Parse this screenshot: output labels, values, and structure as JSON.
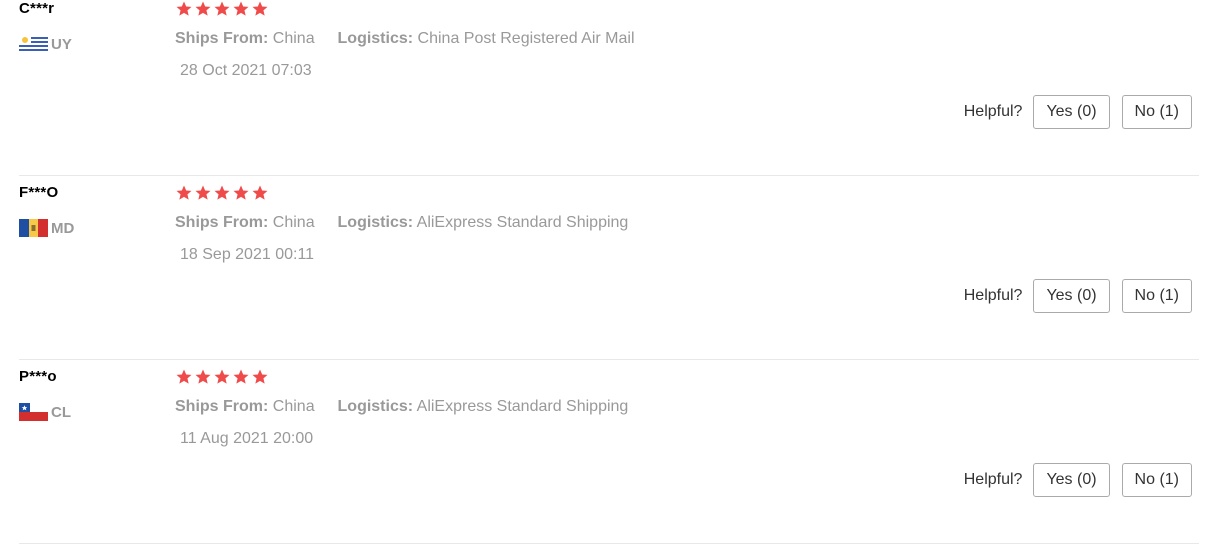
{
  "labels": {
    "ships_from": "Ships From:",
    "logistics": "Logistics:",
    "helpful": "Helpful?"
  },
  "reviews": [
    {
      "user": "C***r",
      "country_code": "UY",
      "flag": "uruguay-flag-icon",
      "rating": 5,
      "ships_from": "China",
      "logistics": "China Post Registered Air Mail",
      "date": "28 Oct 2021 07:03",
      "yes_label": "Yes (0)",
      "no_label": "No (1)"
    },
    {
      "user": "F***O",
      "country_code": "MD",
      "flag": "moldova-flag-icon",
      "rating": 5,
      "ships_from": "China",
      "logistics": "AliExpress Standard Shipping",
      "date": "18 Sep 2021 00:11",
      "yes_label": "Yes (0)",
      "no_label": "No (1)"
    },
    {
      "user": "P***o",
      "country_code": "CL",
      "flag": "chile-flag-icon",
      "rating": 5,
      "ships_from": "China",
      "logistics": "AliExpress Standard Shipping",
      "date": "11 Aug 2021 20:00",
      "yes_label": "Yes (0)",
      "no_label": "No (1)"
    }
  ],
  "colors": {
    "star": "#f04b4b",
    "muted_text": "#999999",
    "divider": "#e8e8e8"
  }
}
